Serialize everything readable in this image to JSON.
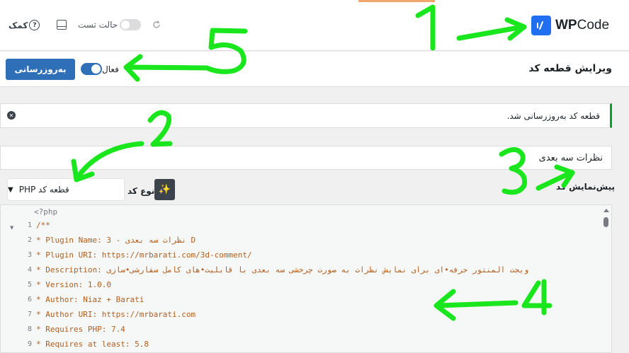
{
  "header": {
    "logo_text_bold": "WP",
    "logo_text": "Code",
    "test_mode_label": "حالت تست",
    "help_label": "کمک",
    "help_glyph": "?",
    "icons": [
      "wpcode-logo-icon",
      "help-icon",
      "panel-icon",
      "refresh-icon"
    ]
  },
  "editbar": {
    "title": "ویرایش قطعه کد",
    "active_label": "فعال",
    "active": true,
    "update_button": "به‌روزرسانی"
  },
  "notice": {
    "message": "قطعه کد به‌روزرسانی شد.",
    "close_glyph": "✕",
    "color": "#00a32a"
  },
  "snippet_title": "نظرات سه بعدی",
  "preview": {
    "label": "پیش‌نمایش کد",
    "code_type_label": "نوع کد",
    "code_type_value": "قطعه کد PHP",
    "sparkle_glyph": "✨"
  },
  "code": {
    "php_open_tag": "<?php",
    "lines": [
      {
        "n": "1",
        "text": "/**"
      },
      {
        "n": "2",
        "text": " * Plugin Name: 3 - نظرات سه بعدی D"
      },
      {
        "n": "3",
        "text": " * Plugin URI:  https://mrbarati.com/3d-comment/"
      },
      {
        "n": "4",
        "text": " * Description: ویجت المنتور حرفه•ای برای نمایش نظرات به صورت چرخشی سه بعدی با قابلیت•های کامل سفارشی•سازی"
      },
      {
        "n": "5",
        "text": " * Version: 1.0.0"
      },
      {
        "n": "6",
        "text": " * Author: Niaz + Barati"
      },
      {
        "n": "7",
        "text": " * Author URI: https://mrbarati.com"
      },
      {
        "n": "8",
        "text": " * Requires PHP: 7.4"
      },
      {
        "n": "9",
        "text": " * Requires at least: 5.8"
      }
    ]
  },
  "annotations": {
    "color": "#19e61c",
    "labels": [
      "1",
      "2",
      "3",
      "4",
      "5"
    ]
  },
  "colors": {
    "primary": "#2f6fb8",
    "logo_blue": "#1f6ff0",
    "code_comment": "#b15e1e"
  }
}
